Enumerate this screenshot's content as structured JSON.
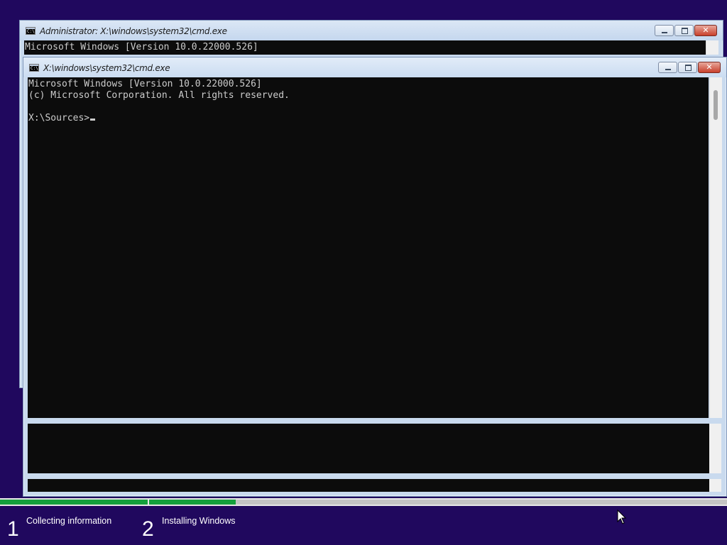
{
  "background_color": "#20085e",
  "windows": [
    {
      "title": "Administrator: X:\\windows\\system32\\cmd.exe",
      "icon": "cmd-icon",
      "icon_text": "C:\\",
      "lines": [
        "Microsoft Windows [Version 10.0.22000.526]"
      ]
    },
    {
      "title": "X:\\windows\\system32\\cmd.exe",
      "icon": "cmd-icon",
      "icon_text": "C:\\",
      "lines": [
        "Microsoft Windows [Version 10.0.22000.526]",
        "(c) Microsoft Corporation. All rights reserved.",
        "",
        "X:\\Sources>"
      ]
    }
  ],
  "window_controls": {
    "minimize": "minimize-icon",
    "maximize": "maximize-icon",
    "close": "close-icon",
    "close_glyph": "✕"
  },
  "progress": {
    "color": "#14a03c",
    "step1_fill": 1.0,
    "step2_fill": 0.15
  },
  "steps": [
    {
      "number": "1",
      "label": "Collecting information"
    },
    {
      "number": "2",
      "label": "Installing Windows"
    }
  ]
}
